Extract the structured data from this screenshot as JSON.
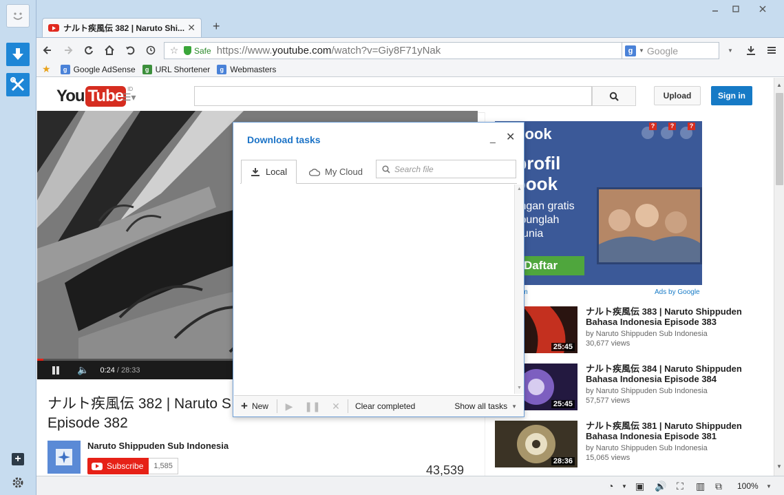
{
  "colors": {
    "sidebar": "#c7dcef",
    "accent": "#1e86d6",
    "youtube_red": "#e62117",
    "signin_blue": "#167ac6",
    "panel_title": "#1d74c7",
    "facebook_blue": "#3b5998",
    "safe_green": "#2c8a2c"
  },
  "browser": {
    "tab": {
      "title": "ナルト疾風伝 382 | Naruto Shi...",
      "close_icon": "close-icon",
      "favicon": "youtube-favicon"
    },
    "new_tab_label": "+",
    "window": {
      "minimize": "minimize-icon",
      "maximize": "maximize-icon",
      "close": "close-icon"
    },
    "address": {
      "safe_label": "Safe",
      "url_prefix": "https://www.",
      "url_domain": "youtube.com",
      "url_path": "/watch?v=Giy8F71yNak"
    },
    "search": {
      "engine": "Google",
      "placeholder": "Google"
    },
    "bookmarks": [
      {
        "label": "Google AdSense"
      },
      {
        "label": "URL Shortener"
      },
      {
        "label": "Webmasters"
      }
    ],
    "zoom": "100%"
  },
  "youtube": {
    "logo": {
      "you": "You",
      "tube": "Tube",
      "region": "ID"
    },
    "upload_label": "Upload",
    "signin_label": "Sign in",
    "player": {
      "current_time": "0:24",
      "duration": "/ 28:33",
      "progress_fraction": 0.014
    },
    "video": {
      "title": "ナルト疾風伝 382 | Naruto Shippuden Bahasa Indonesia Episode 382",
      "title_line1": "ナルト疾風伝 382 | Naruto S",
      "title_line2": "Episode 382",
      "channel": "Naruto Shippuden Sub Indonesia",
      "subscribe_label": "Subscribe",
      "subscriber_count": "1,585",
      "view_count": "43,539"
    },
    "ad": {
      "brand": "facebook",
      "line1": "at profil",
      "line2": "cebook",
      "sub1": "ar dengan gratis",
      "sub2": "terhubunglah",
      "sub3": "gan dunia",
      "cta": "Daftar",
      "url": ".com",
      "ads_by": "Ads by Google"
    },
    "related": [
      {
        "title_line1": "ナルト疾風伝 383 | Naruto Shippuden",
        "title_line2": "Bahasa Indonesia Episode 383",
        "by": "by Naruto Shippuden Sub Indonesia",
        "views": "30,677 views",
        "duration": "25:45",
        "thumb_color": "#b8281d"
      },
      {
        "title_line1": "ナルト疾風伝 384 | Naruto Shippuden",
        "title_line2": "Bahasa Indonesia Episode 384",
        "by": "by Naruto Shippuden Sub Indonesia",
        "views": "57,577 views",
        "duration": "25:45",
        "thumb_color": "#6a4fa8"
      },
      {
        "title_line1": "ナルト疾風伝 381 | Naruto Shippuden",
        "title_line2": "Bahasa Indonesia Episode 381",
        "by": "by Naruto Shippuden Sub Indonesia",
        "views": "15,065 views",
        "duration": "28:36",
        "thumb_color": "#8a7a55"
      }
    ]
  },
  "download_panel": {
    "title": "Download tasks",
    "tabs": {
      "local": "Local",
      "cloud": "My Cloud"
    },
    "search_placeholder": "Search file",
    "footer": {
      "new_label": "New",
      "clear_label": "Clear completed",
      "show_label": "Show all tasks"
    }
  }
}
